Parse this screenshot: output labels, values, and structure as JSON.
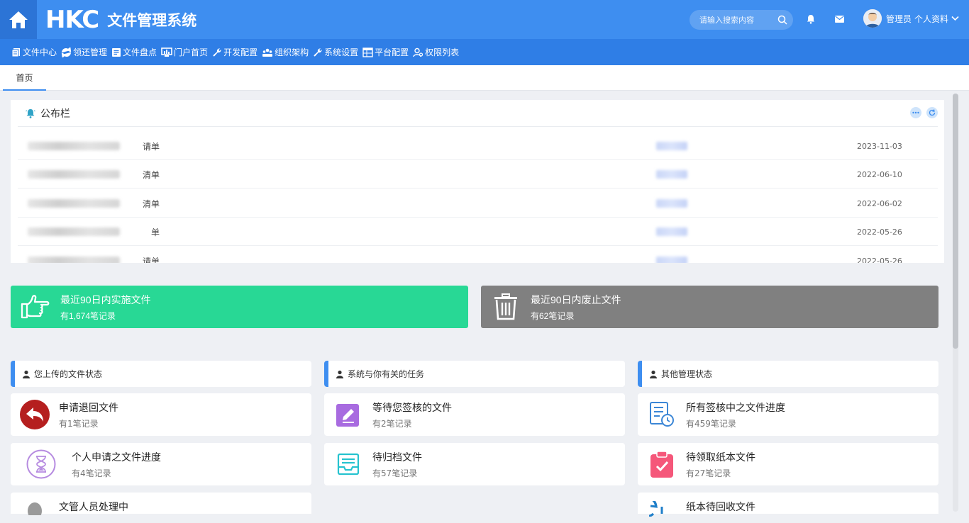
{
  "header": {
    "logo": "HKC",
    "system_title": "文件管理系统",
    "search_placeholder": "请输入搜索内容",
    "user_name": "管理员",
    "user_profile": "个人资料"
  },
  "menu": [
    {
      "label": "文件中心",
      "icon": "file-icon"
    },
    {
      "label": "领还管理",
      "icon": "exchange-icon"
    },
    {
      "label": "文件盘点",
      "icon": "list-icon"
    },
    {
      "label": "门户首页",
      "icon": "monitor-icon"
    },
    {
      "label": "开发配置",
      "icon": "wrench-icon"
    },
    {
      "label": "组织架构",
      "icon": "org-icon"
    },
    {
      "label": "系统设置",
      "icon": "wrench-icon"
    },
    {
      "label": "平台配置",
      "icon": "table-icon"
    },
    {
      "label": "权限列表",
      "icon": "users-icon"
    }
  ],
  "tabs": [
    {
      "label": "首页"
    }
  ],
  "bulletin": {
    "title": "公布栏",
    "rows": [
      {
        "name_tail": "请单",
        "date": "2023-11-03"
      },
      {
        "name_tail": "清单",
        "date": "2022-06-10"
      },
      {
        "name_tail": "清单",
        "date": "2022-06-02"
      },
      {
        "name_tail": "单",
        "date": "2022-05-26"
      },
      {
        "name_tail": "请单",
        "date": "2022-05-26"
      }
    ]
  },
  "stats": {
    "implemented": {
      "title": "最近90日内实施文件",
      "count_text": "有1,674笔记录",
      "color": "#28d895"
    },
    "abolished": {
      "title": "最近90日内废止文件",
      "count_text": "有62笔记录",
      "color": "#808080"
    }
  },
  "sections": [
    {
      "label": "您上传的文件状态"
    },
    {
      "label": "系统与你有关的任务"
    },
    {
      "label": "其他管理状态"
    }
  ],
  "tiles": {
    "col1": [
      {
        "title": "申请退回文件",
        "count": "有1笔记录"
      },
      {
        "title": "个人申请之文件进度",
        "count": "有4笔记录"
      },
      {
        "title": "文管人员处理中",
        "count": ""
      }
    ],
    "col2": [
      {
        "title": "等待您签核的文件",
        "count": "有2笔记录"
      },
      {
        "title": "待归档文件",
        "count": "有57笔记录"
      }
    ],
    "col3": [
      {
        "title": "所有签核中之文件进度",
        "count": "有459笔记录"
      },
      {
        "title": "待领取纸本文件",
        "count": "有27笔记录"
      },
      {
        "title": "纸本待回收文件",
        "count": ""
      }
    ]
  }
}
